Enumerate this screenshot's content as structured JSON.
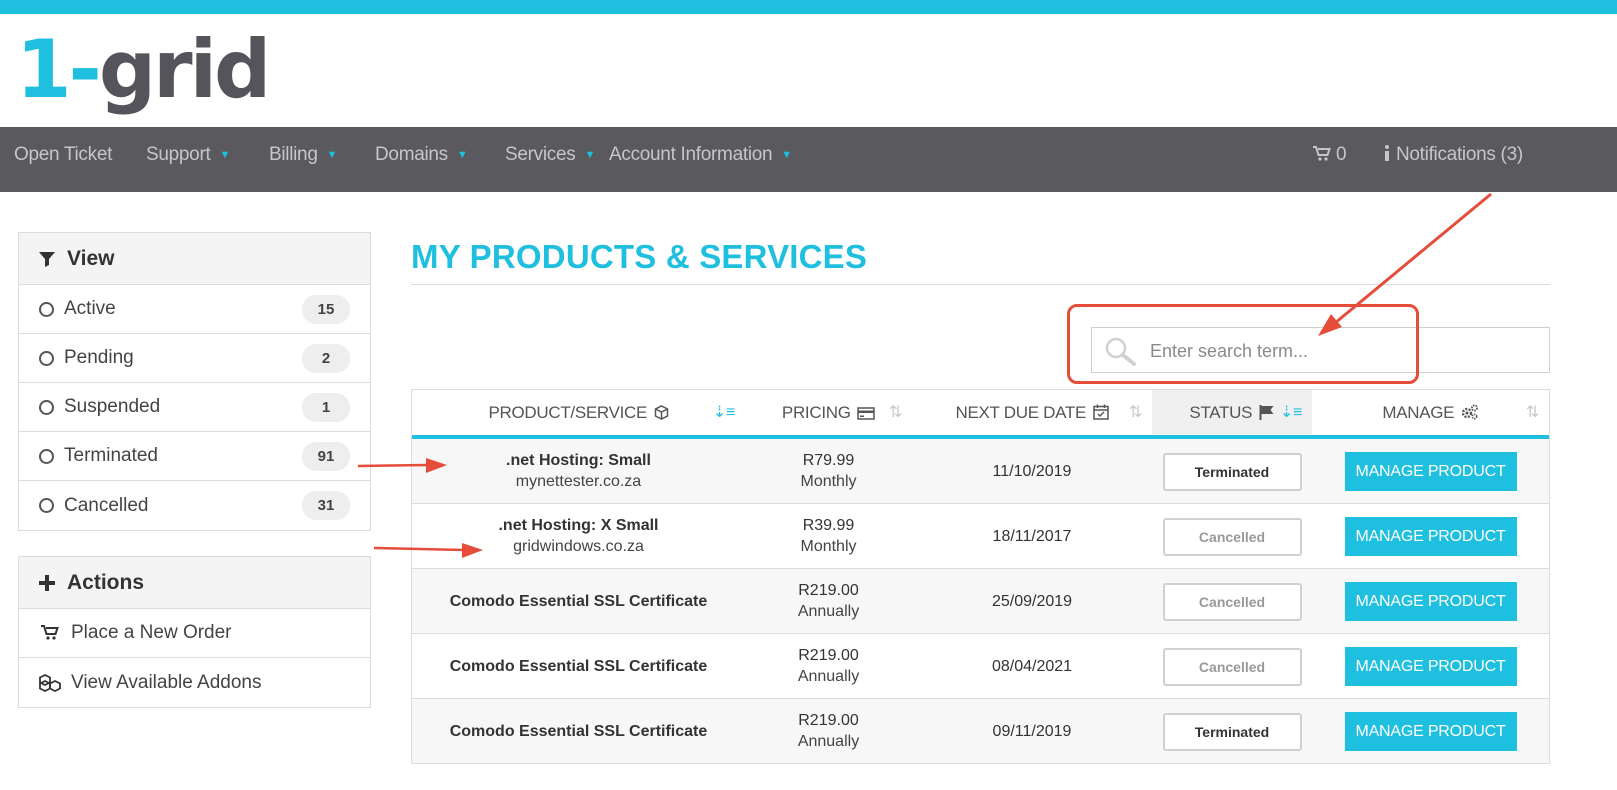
{
  "brand": {
    "logo_one": "1-",
    "logo_rest": "grid",
    "accent": "#1fbfe0",
    "dark": "#59595e"
  },
  "nav": {
    "items": [
      {
        "label": "Open Ticket",
        "dropdown": false
      },
      {
        "label": "Support",
        "dropdown": true
      },
      {
        "label": "Billing",
        "dropdown": true
      },
      {
        "label": "Domains",
        "dropdown": true
      },
      {
        "label": "Services",
        "dropdown": true
      },
      {
        "label": "Account Information",
        "dropdown": true
      }
    ],
    "cart_count": "0",
    "notifications": "Notifications (3)"
  },
  "view_panel": {
    "title": "View",
    "filters": [
      {
        "label": "Active",
        "count": "15"
      },
      {
        "label": "Pending",
        "count": "2"
      },
      {
        "label": "Suspended",
        "count": "1"
      },
      {
        "label": "Terminated",
        "count": "91"
      },
      {
        "label": "Cancelled",
        "count": "31"
      }
    ]
  },
  "actions_panel": {
    "title": "Actions",
    "items": [
      {
        "label": "Place a New Order",
        "icon": "cart-icon"
      },
      {
        "label": "View Available Addons",
        "icon": "cubes-icon"
      }
    ]
  },
  "page": {
    "title": "MY PRODUCTS & SERVICES"
  },
  "search": {
    "placeholder": "Enter search term..."
  },
  "table": {
    "headers": [
      "PRODUCT/SERVICE",
      "PRICING",
      "NEXT DUE DATE",
      "STATUS",
      "MANAGE"
    ],
    "rows": [
      {
        "product": ".net Hosting: Small",
        "domain": "mynettester.co.za",
        "price": "R79.99",
        "cycle": "Monthly",
        "due": "11/10/2019",
        "status": "Terminated",
        "action": "MANAGE PRODUCT"
      },
      {
        "product": ".net Hosting: X Small",
        "domain": "gridwindows.co.za",
        "price": "R39.99",
        "cycle": "Monthly",
        "due": "18/11/2017",
        "status": "Cancelled",
        "action": "MANAGE PRODUCT"
      },
      {
        "product": "Comodo Essential SSL Certificate",
        "domain": "",
        "price": "R219.00",
        "cycle": "Annually",
        "due": "25/09/2019",
        "status": "Cancelled",
        "action": "MANAGE PRODUCT"
      },
      {
        "product": "Comodo Essential SSL Certificate",
        "domain": "",
        "price": "R219.00",
        "cycle": "Annually",
        "due": "08/04/2021",
        "status": "Cancelled",
        "action": "MANAGE PRODUCT"
      },
      {
        "product": "Comodo Essential SSL Certificate",
        "domain": "",
        "price": "R219.00",
        "cycle": "Annually",
        "due": "09/11/2019",
        "status": "Terminated",
        "action": "MANAGE PRODUCT"
      }
    ]
  },
  "annotations": {
    "arrow_color": "#e54d3a"
  }
}
